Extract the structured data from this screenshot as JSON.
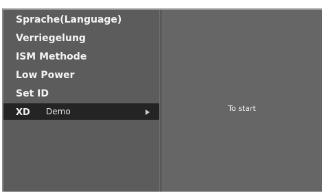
{
  "menu": {
    "items": [
      {
        "label": "Sprache(Language)"
      },
      {
        "label": "Verriegelung"
      },
      {
        "label": "ISM Methode"
      },
      {
        "label": "Low Power"
      },
      {
        "label": "Set ID"
      },
      {
        "label": "Demo",
        "logo": "XD",
        "icon": "arrow-right-icon",
        "selected": true
      }
    ]
  },
  "panel": {
    "text": "To start"
  },
  "colors": {
    "menu_bg": "#5c5c5c",
    "panel_bg": "#666666",
    "selected_bg": "#242424",
    "text": "#f4f4f4"
  }
}
